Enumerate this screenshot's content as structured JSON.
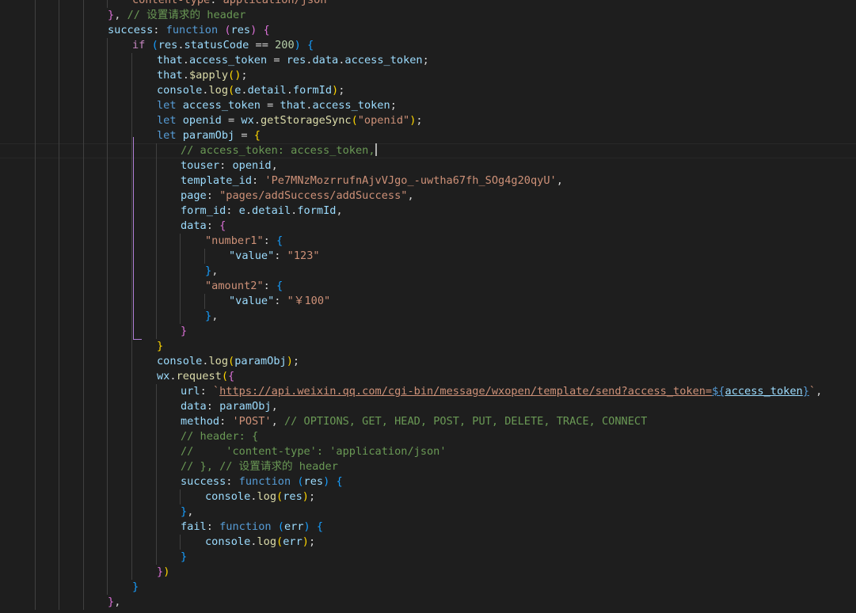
{
  "colors": {
    "background": "#1e1e1e",
    "keyword": "#569cd6",
    "control": "#c586c0",
    "variable": "#9cdcfe",
    "function": "#dcdcaa",
    "string": "#ce9178",
    "number": "#b5cea8",
    "comment": "#6a9955",
    "bracket_gold": "#ffd700",
    "bracket_purple": "#da70d6",
    "bracket_blue": "#179fff"
  },
  "lines": [
    {
      "indent": 5,
      "tokens": [
        [
          "content-type",
          "#ce9178"
        ],
        [
          ": ",
          "#d4d4d4"
        ],
        [
          "application/json",
          "#ce9178"
        ]
      ]
    },
    {
      "indent": 4,
      "tokens": [
        [
          "}",
          "#da70d6"
        ],
        [
          ", ",
          "#d4d4d4"
        ],
        [
          "// 设置请求的 header",
          "#6a9955"
        ]
      ]
    },
    {
      "indent": 4,
      "tokens": [
        [
          "success",
          "#9cdcfe"
        ],
        [
          ": ",
          "#d4d4d4"
        ],
        [
          "function",
          "#569cd6"
        ],
        [
          " ",
          "#d4d4d4"
        ],
        [
          "(",
          "#da70d6"
        ],
        [
          "res",
          "#9cdcfe"
        ],
        [
          ")",
          "#da70d6"
        ],
        [
          " ",
          "#d4d4d4"
        ],
        [
          "{",
          "#da70d6"
        ]
      ]
    },
    {
      "indent": 5,
      "tokens": [
        [
          "if",
          "#c586c0"
        ],
        [
          " ",
          "#d4d4d4"
        ],
        [
          "(",
          "#179fff"
        ],
        [
          "res",
          "#9cdcfe"
        ],
        [
          ".",
          "#d4d4d4"
        ],
        [
          "statusCode",
          "#9cdcfe"
        ],
        [
          " == ",
          "#d4d4d4"
        ],
        [
          "200",
          "#b5cea8"
        ],
        [
          ")",
          "#179fff"
        ],
        [
          " ",
          "#d4d4d4"
        ],
        [
          "{",
          "#179fff"
        ]
      ]
    },
    {
      "indent": 6,
      "tokens": [
        [
          "that",
          "#9cdcfe"
        ],
        [
          ".",
          "#d4d4d4"
        ],
        [
          "access_token",
          "#9cdcfe"
        ],
        [
          " = ",
          "#d4d4d4"
        ],
        [
          "res",
          "#9cdcfe"
        ],
        [
          ".",
          "#d4d4d4"
        ],
        [
          "data",
          "#9cdcfe"
        ],
        [
          ".",
          "#d4d4d4"
        ],
        [
          "access_token",
          "#9cdcfe"
        ],
        [
          ";",
          "#d4d4d4"
        ]
      ]
    },
    {
      "indent": 6,
      "tokens": [
        [
          "that",
          "#9cdcfe"
        ],
        [
          ".",
          "#d4d4d4"
        ],
        [
          "$apply",
          "#dcdcaa"
        ],
        [
          "()",
          "#ffd700"
        ],
        [
          ";",
          "#d4d4d4"
        ]
      ]
    },
    {
      "indent": 6,
      "tokens": [
        [
          "console",
          "#9cdcfe"
        ],
        [
          ".",
          "#d4d4d4"
        ],
        [
          "log",
          "#dcdcaa"
        ],
        [
          "(",
          "#ffd700"
        ],
        [
          "e",
          "#9cdcfe"
        ],
        [
          ".",
          "#d4d4d4"
        ],
        [
          "detail",
          "#9cdcfe"
        ],
        [
          ".",
          "#d4d4d4"
        ],
        [
          "formId",
          "#9cdcfe"
        ],
        [
          ")",
          "#ffd700"
        ],
        [
          ";",
          "#d4d4d4"
        ]
      ]
    },
    {
      "indent": 6,
      "tokens": [
        [
          "let",
          "#569cd6"
        ],
        [
          " ",
          "#d4d4d4"
        ],
        [
          "access_token",
          "#9cdcfe"
        ],
        [
          " = ",
          "#d4d4d4"
        ],
        [
          "that",
          "#9cdcfe"
        ],
        [
          ".",
          "#d4d4d4"
        ],
        [
          "access_token",
          "#9cdcfe"
        ],
        [
          ";",
          "#d4d4d4"
        ]
      ]
    },
    {
      "indent": 6,
      "tokens": [
        [
          "let",
          "#569cd6"
        ],
        [
          " ",
          "#d4d4d4"
        ],
        [
          "openid",
          "#9cdcfe"
        ],
        [
          " = ",
          "#d4d4d4"
        ],
        [
          "wx",
          "#9cdcfe"
        ],
        [
          ".",
          "#d4d4d4"
        ],
        [
          "getStorageSync",
          "#dcdcaa"
        ],
        [
          "(",
          "#ffd700"
        ],
        [
          "\"openid\"",
          "#ce9178"
        ],
        [
          ")",
          "#ffd700"
        ],
        [
          ";",
          "#d4d4d4"
        ]
      ]
    },
    {
      "indent": 6,
      "tokens": [
        [
          "let",
          "#569cd6"
        ],
        [
          " ",
          "#d4d4d4"
        ],
        [
          "paramObj",
          "#9cdcfe"
        ],
        [
          " = ",
          "#d4d4d4"
        ],
        [
          "{",
          "#ffd700"
        ]
      ]
    },
    {
      "indent": 7,
      "current": true,
      "cursor": true,
      "tokens": [
        [
          "// access_token: access_token,",
          "#6a9955"
        ]
      ]
    },
    {
      "indent": 7,
      "tokens": [
        [
          "touser",
          "#9cdcfe"
        ],
        [
          ": ",
          "#d4d4d4"
        ],
        [
          "openid",
          "#9cdcfe"
        ],
        [
          ",",
          "#d4d4d4"
        ]
      ]
    },
    {
      "indent": 7,
      "tokens": [
        [
          "template_id",
          "#9cdcfe"
        ],
        [
          ": ",
          "#d4d4d4"
        ],
        [
          "'Pe7MNzMozrrufnAjvVJgo_-uwtha67fh_SOg4g20qyU'",
          "#ce9178"
        ],
        [
          ",",
          "#d4d4d4"
        ]
      ]
    },
    {
      "indent": 7,
      "tokens": [
        [
          "page",
          "#9cdcfe"
        ],
        [
          ": ",
          "#d4d4d4"
        ],
        [
          "\"pages/addSuccess/addSuccess\"",
          "#ce9178"
        ],
        [
          ",",
          "#d4d4d4"
        ]
      ]
    },
    {
      "indent": 7,
      "tokens": [
        [
          "form_id",
          "#9cdcfe"
        ],
        [
          ": ",
          "#d4d4d4"
        ],
        [
          "e",
          "#9cdcfe"
        ],
        [
          ".",
          "#d4d4d4"
        ],
        [
          "detail",
          "#9cdcfe"
        ],
        [
          ".",
          "#d4d4d4"
        ],
        [
          "formId",
          "#9cdcfe"
        ],
        [
          ",",
          "#d4d4d4"
        ]
      ]
    },
    {
      "indent": 7,
      "tokens": [
        [
          "data",
          "#9cdcfe"
        ],
        [
          ": ",
          "#d4d4d4"
        ],
        [
          "{",
          "#da70d6"
        ]
      ]
    },
    {
      "indent": 8,
      "tokens": [
        [
          "\"number1\"",
          "#ce9178"
        ],
        [
          ": ",
          "#d4d4d4"
        ],
        [
          "{",
          "#179fff"
        ]
      ]
    },
    {
      "indent": 9,
      "tokens": [
        [
          "\"value\"",
          "#9cdcfe"
        ],
        [
          ": ",
          "#d4d4d4"
        ],
        [
          "\"123\"",
          "#ce9178"
        ]
      ]
    },
    {
      "indent": 8,
      "tokens": [
        [
          "}",
          "#179fff"
        ],
        [
          ",",
          "#d4d4d4"
        ]
      ]
    },
    {
      "indent": 8,
      "tokens": [
        [
          "\"amount2\"",
          "#ce9178"
        ],
        [
          ": ",
          "#d4d4d4"
        ],
        [
          "{",
          "#179fff"
        ]
      ]
    },
    {
      "indent": 9,
      "tokens": [
        [
          "\"value\"",
          "#9cdcfe"
        ],
        [
          ": ",
          "#d4d4d4"
        ],
        [
          "\"￥100\"",
          "#ce9178"
        ]
      ]
    },
    {
      "indent": 8,
      "tokens": [
        [
          "}",
          "#179fff"
        ],
        [
          ",",
          "#d4d4d4"
        ]
      ]
    },
    {
      "indent": 7,
      "tokens": [
        [
          "}",
          "#da70d6"
        ]
      ]
    },
    {
      "indent": 6,
      "tokens": [
        [
          "}",
          "#ffd700"
        ]
      ]
    },
    {
      "indent": 6,
      "tokens": [
        [
          "console",
          "#9cdcfe"
        ],
        [
          ".",
          "#d4d4d4"
        ],
        [
          "log",
          "#dcdcaa"
        ],
        [
          "(",
          "#ffd700"
        ],
        [
          "paramObj",
          "#9cdcfe"
        ],
        [
          ")",
          "#ffd700"
        ],
        [
          ";",
          "#d4d4d4"
        ]
      ]
    },
    {
      "indent": 6,
      "tokens": [
        [
          "wx",
          "#9cdcfe"
        ],
        [
          ".",
          "#d4d4d4"
        ],
        [
          "request",
          "#dcdcaa"
        ],
        [
          "(",
          "#ffd700"
        ],
        [
          "{",
          "#da70d6"
        ]
      ]
    },
    {
      "indent": 7,
      "tokens": [
        [
          "url",
          "#9cdcfe"
        ],
        [
          ": ",
          "#d4d4d4"
        ],
        [
          "`",
          "#ce9178"
        ],
        [
          "https://api.weixin.qq.com/cgi-bin/message/wxopen/template/send?access_token=",
          "#ce9178",
          "u"
        ],
        [
          "${",
          "#569cd6",
          "u"
        ],
        [
          "access_token",
          "#9cdcfe",
          "u"
        ],
        [
          "}",
          "#569cd6",
          "u"
        ],
        [
          "`",
          "#ce9178"
        ],
        [
          ",",
          "#d4d4d4"
        ]
      ]
    },
    {
      "indent": 7,
      "tokens": [
        [
          "data",
          "#9cdcfe"
        ],
        [
          ": ",
          "#d4d4d4"
        ],
        [
          "paramObj",
          "#9cdcfe"
        ],
        [
          ",",
          "#d4d4d4"
        ]
      ]
    },
    {
      "indent": 7,
      "tokens": [
        [
          "method",
          "#9cdcfe"
        ],
        [
          ": ",
          "#d4d4d4"
        ],
        [
          "'POST'",
          "#ce9178"
        ],
        [
          ", ",
          "#d4d4d4"
        ],
        [
          "// OPTIONS, GET, HEAD, POST, PUT, DELETE, TRACE, CONNECT",
          "#6a9955"
        ]
      ]
    },
    {
      "indent": 7,
      "tokens": [
        [
          "// header: {",
          "#6a9955"
        ]
      ]
    },
    {
      "indent": 7,
      "tokens": [
        [
          "//     'content-type': 'application/json'",
          "#6a9955"
        ]
      ]
    },
    {
      "indent": 7,
      "tokens": [
        [
          "// }, // 设置请求的 header",
          "#6a9955"
        ]
      ]
    },
    {
      "indent": 7,
      "tokens": [
        [
          "success",
          "#9cdcfe"
        ],
        [
          ": ",
          "#d4d4d4"
        ],
        [
          "function",
          "#569cd6"
        ],
        [
          " ",
          "#d4d4d4"
        ],
        [
          "(",
          "#179fff"
        ],
        [
          "res",
          "#9cdcfe"
        ],
        [
          ")",
          "#179fff"
        ],
        [
          " ",
          "#d4d4d4"
        ],
        [
          "{",
          "#179fff"
        ]
      ]
    },
    {
      "indent": 8,
      "tokens": [
        [
          "console",
          "#9cdcfe"
        ],
        [
          ".",
          "#d4d4d4"
        ],
        [
          "log",
          "#dcdcaa"
        ],
        [
          "(",
          "#ffd700"
        ],
        [
          "res",
          "#9cdcfe"
        ],
        [
          ")",
          "#ffd700"
        ],
        [
          ";",
          "#d4d4d4"
        ]
      ]
    },
    {
      "indent": 7,
      "tokens": [
        [
          "}",
          "#179fff"
        ],
        [
          ",",
          "#d4d4d4"
        ]
      ]
    },
    {
      "indent": 7,
      "tokens": [
        [
          "fail",
          "#9cdcfe"
        ],
        [
          ": ",
          "#d4d4d4"
        ],
        [
          "function",
          "#569cd6"
        ],
        [
          " ",
          "#d4d4d4"
        ],
        [
          "(",
          "#179fff"
        ],
        [
          "err",
          "#9cdcfe"
        ],
        [
          ")",
          "#179fff"
        ],
        [
          " ",
          "#d4d4d4"
        ],
        [
          "{",
          "#179fff"
        ]
      ]
    },
    {
      "indent": 8,
      "tokens": [
        [
          "console",
          "#9cdcfe"
        ],
        [
          ".",
          "#d4d4d4"
        ],
        [
          "log",
          "#dcdcaa"
        ],
        [
          "(",
          "#ffd700"
        ],
        [
          "err",
          "#9cdcfe"
        ],
        [
          ")",
          "#ffd700"
        ],
        [
          ";",
          "#d4d4d4"
        ]
      ]
    },
    {
      "indent": 7,
      "tokens": [
        [
          "}",
          "#179fff"
        ]
      ]
    },
    {
      "indent": 6,
      "tokens": [
        [
          "}",
          "#da70d6"
        ],
        [
          ")",
          "#ffd700"
        ]
      ]
    },
    {
      "indent": 5,
      "tokens": [
        [
          "}",
          "#179fff"
        ]
      ]
    },
    {
      "indent": 4,
      "tokens": [
        [
          "}",
          "#da70d6"
        ],
        [
          ",",
          "#d4d4d4"
        ]
      ]
    }
  ]
}
